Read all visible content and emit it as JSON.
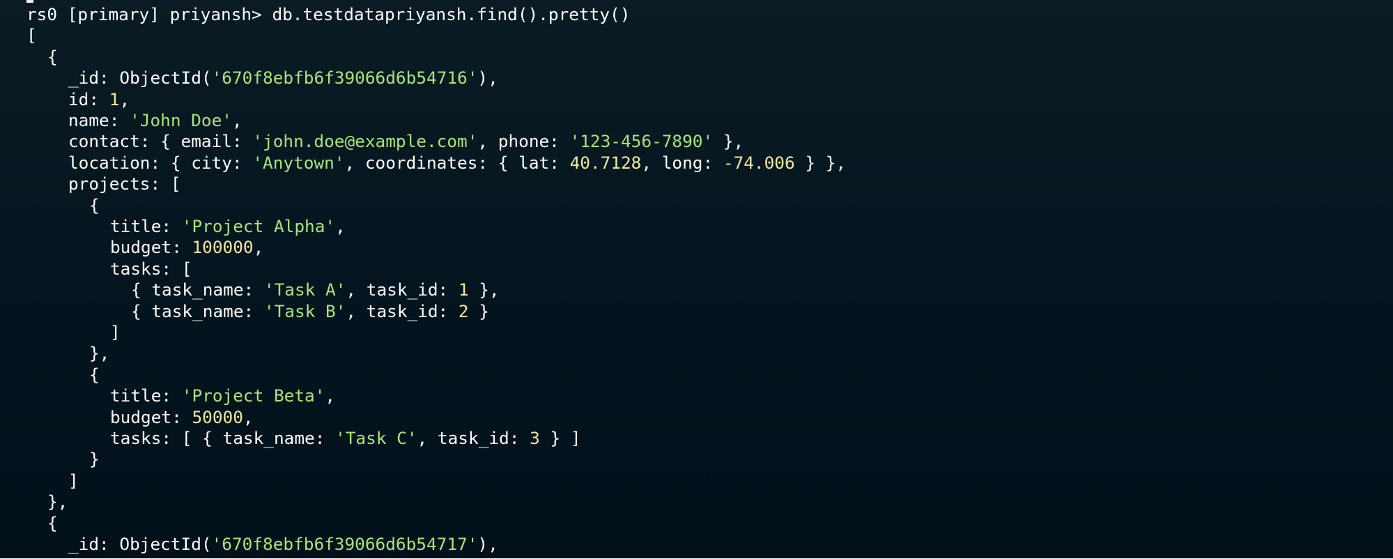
{
  "window": {
    "type": "terminal",
    "shell": "mongosh"
  },
  "theme": {
    "background": "#04151f",
    "text": "#ffffff",
    "string": "#a9e57a",
    "number": "#f3e7a0"
  },
  "terminal": {
    "lines": [
      {
        "indent": 0,
        "tokens": [
          {
            "k": "prompt",
            "t": "rs0 [primary] priyansh> "
          },
          {
            "k": "cmd",
            "t": "db.testdatapriyansh.find().pretty()"
          }
        ]
      },
      {
        "indent": 0,
        "tokens": [
          {
            "k": "plain",
            "t": "["
          }
        ]
      },
      {
        "indent": 1,
        "tokens": [
          {
            "k": "plain",
            "t": "{"
          }
        ]
      },
      {
        "indent": 2,
        "tokens": [
          {
            "k": "plain",
            "t": "_id: ObjectId("
          },
          {
            "k": "str",
            "t": "'670f8ebfb6f39066d6b54716'"
          },
          {
            "k": "plain",
            "t": "),"
          }
        ]
      },
      {
        "indent": 2,
        "tokens": [
          {
            "k": "plain",
            "t": "id: "
          },
          {
            "k": "num",
            "t": "1"
          },
          {
            "k": "plain",
            "t": ","
          }
        ]
      },
      {
        "indent": 2,
        "tokens": [
          {
            "k": "plain",
            "t": "name: "
          },
          {
            "k": "str",
            "t": "'John Doe'"
          },
          {
            "k": "plain",
            "t": ","
          }
        ]
      },
      {
        "indent": 2,
        "tokens": [
          {
            "k": "plain",
            "t": "contact: { email: "
          },
          {
            "k": "str",
            "t": "'john.doe@example.com'"
          },
          {
            "k": "plain",
            "t": ", phone: "
          },
          {
            "k": "str",
            "t": "'123-456-7890'"
          },
          {
            "k": "plain",
            "t": " },"
          }
        ]
      },
      {
        "indent": 2,
        "tokens": [
          {
            "k": "plain",
            "t": "location: { city: "
          },
          {
            "k": "str",
            "t": "'Anytown'"
          },
          {
            "k": "plain",
            "t": ", coordinates: { lat: "
          },
          {
            "k": "num",
            "t": "40.7128"
          },
          {
            "k": "plain",
            "t": ", long: "
          },
          {
            "k": "num",
            "t": "-74.006"
          },
          {
            "k": "plain",
            "t": " } },"
          }
        ]
      },
      {
        "indent": 2,
        "tokens": [
          {
            "k": "plain",
            "t": "projects: ["
          }
        ]
      },
      {
        "indent": 3,
        "tokens": [
          {
            "k": "plain",
            "t": "{"
          }
        ]
      },
      {
        "indent": 4,
        "tokens": [
          {
            "k": "plain",
            "t": "title: "
          },
          {
            "k": "str",
            "t": "'Project Alpha'"
          },
          {
            "k": "plain",
            "t": ","
          }
        ]
      },
      {
        "indent": 4,
        "tokens": [
          {
            "k": "plain",
            "t": "budget: "
          },
          {
            "k": "num",
            "t": "100000"
          },
          {
            "k": "plain",
            "t": ","
          }
        ]
      },
      {
        "indent": 4,
        "tokens": [
          {
            "k": "plain",
            "t": "tasks: ["
          }
        ]
      },
      {
        "indent": 5,
        "tokens": [
          {
            "k": "plain",
            "t": "{ task_name: "
          },
          {
            "k": "str",
            "t": "'Task A'"
          },
          {
            "k": "plain",
            "t": ", task_id: "
          },
          {
            "k": "num",
            "t": "1"
          },
          {
            "k": "plain",
            "t": " },"
          }
        ]
      },
      {
        "indent": 5,
        "tokens": [
          {
            "k": "plain",
            "t": "{ task_name: "
          },
          {
            "k": "str",
            "t": "'Task B'"
          },
          {
            "k": "plain",
            "t": ", task_id: "
          },
          {
            "k": "num",
            "t": "2"
          },
          {
            "k": "plain",
            "t": " }"
          }
        ]
      },
      {
        "indent": 4,
        "tokens": [
          {
            "k": "plain",
            "t": "]"
          }
        ]
      },
      {
        "indent": 3,
        "tokens": [
          {
            "k": "plain",
            "t": "},"
          }
        ]
      },
      {
        "indent": 3,
        "tokens": [
          {
            "k": "plain",
            "t": "{"
          }
        ]
      },
      {
        "indent": 4,
        "tokens": [
          {
            "k": "plain",
            "t": "title: "
          },
          {
            "k": "str",
            "t": "'Project Beta'"
          },
          {
            "k": "plain",
            "t": ","
          }
        ]
      },
      {
        "indent": 4,
        "tokens": [
          {
            "k": "plain",
            "t": "budget: "
          },
          {
            "k": "num",
            "t": "50000"
          },
          {
            "k": "plain",
            "t": ","
          }
        ]
      },
      {
        "indent": 4,
        "tokens": [
          {
            "k": "plain",
            "t": "tasks: [ { task_name: "
          },
          {
            "k": "str",
            "t": "'Task C'"
          },
          {
            "k": "plain",
            "t": ", task_id: "
          },
          {
            "k": "num",
            "t": "3"
          },
          {
            "k": "plain",
            "t": " } ]"
          }
        ]
      },
      {
        "indent": 3,
        "tokens": [
          {
            "k": "plain",
            "t": "}"
          }
        ]
      },
      {
        "indent": 2,
        "tokens": [
          {
            "k": "plain",
            "t": "]"
          }
        ]
      },
      {
        "indent": 1,
        "tokens": [
          {
            "k": "plain",
            "t": "},"
          }
        ]
      },
      {
        "indent": 1,
        "tokens": [
          {
            "k": "plain",
            "t": "{"
          }
        ]
      },
      {
        "indent": 2,
        "tokens": [
          {
            "k": "plain",
            "t": "_id: ObjectId("
          },
          {
            "k": "str",
            "t": "'670f8ebfb6f39066d6b54717'"
          },
          {
            "k": "plain",
            "t": "),"
          }
        ]
      }
    ]
  }
}
